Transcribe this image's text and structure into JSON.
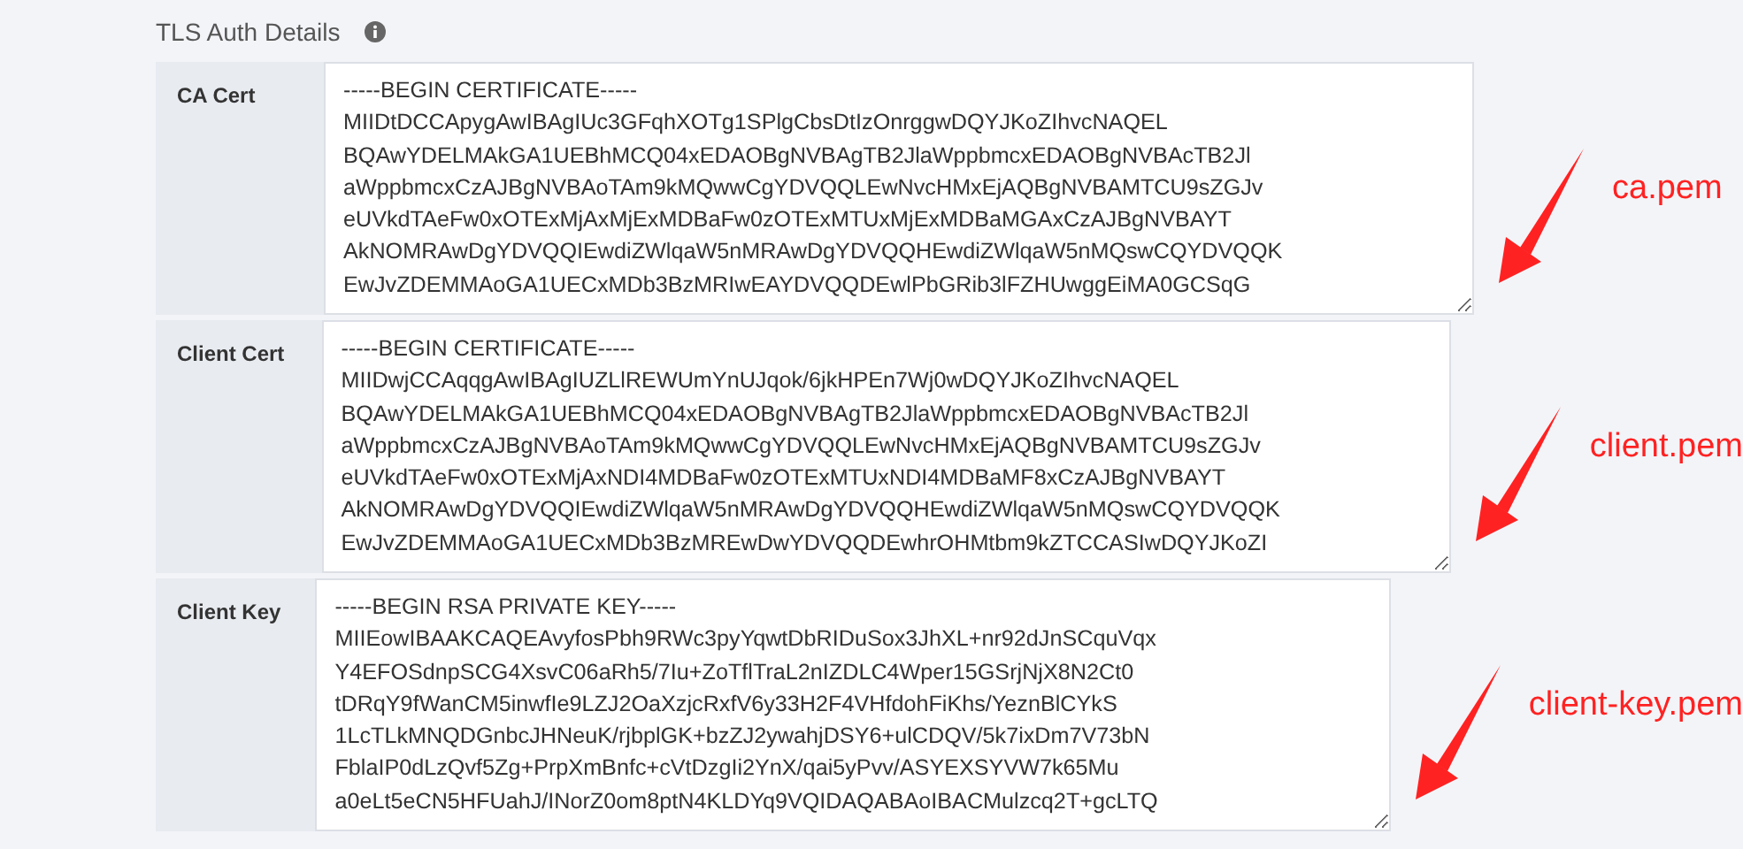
{
  "section": {
    "title": "TLS Auth Details"
  },
  "fields": [
    {
      "label": "CA Cert",
      "value": "-----BEGIN CERTIFICATE-----\nMIIDtDCCApygAwIBAgIUc3GFqhXOTg1SPlgCbsDtIzOnrggwDQYJKoZIhvcNAQEL\nBQAwYDELMAkGA1UEBhMCQ04xEDAOBgNVBAgTB2JlaWppbmcxEDAOBgNVBAcTB2Jl\naWppbmcxCzAJBgNVBAoTAm9kMQwwCgYDVQQLEwNvcHMxEjAQBgNVBAMTCU9sZGJv\neUVkdTAeFw0xOTExMjAxMjExMDBaFw0zOTExMTUxMjExMDBaMGAxCzAJBgNVBAYT\nAkNOMRAwDgYDVQQIEwdiZWlqaW5nMRAwDgYDVQQHEwdiZWlqaW5nMQswCQYDVQQK\nEwJvZDEMMAoGA1UECxMDb3BzMRIwEAYDVQQDEwlPbGRib3lFZHUwggEiMA0GCSqG",
      "annotation": "ca.pem"
    },
    {
      "label": "Client Cert",
      "value": "-----BEGIN CERTIFICATE-----\nMIIDwjCCAqqgAwIBAgIUZLlREWUmYnUJqok/6jkHPEn7Wj0wDQYJKoZIhvcNAQEL\nBQAwYDELMAkGA1UEBhMCQ04xEDAOBgNVBAgTB2JlaWppbmcxEDAOBgNVBAcTB2Jl\naWppbmcxCzAJBgNVBAoTAm9kMQwwCgYDVQQLEwNvcHMxEjAQBgNVBAMTCU9sZGJv\neUVkdTAeFw0xOTExMjAxNDI4MDBaFw0zOTExMTUxNDI4MDBaMF8xCzAJBgNVBAYT\nAkNOMRAwDgYDVQQIEwdiZWlqaW5nMRAwDgYDVQQHEwdiZWlqaW5nMQswCQYDVQQK\nEwJvZDEMMAoGA1UECxMDb3BzMREwDwYDVQQDEwhrOHMtbm9kZTCCASIwDQYJKoZI",
      "annotation": "client.pem"
    },
    {
      "label": "Client Key",
      "value": "-----BEGIN RSA PRIVATE KEY-----\nMIIEowIBAAKCAQEAvyfosPbh9RWc3pyYqwtDbRIDuSox3JhXL+nr92dJnSCquVqx\nY4EFOSdnpSCG4XsvC06aRh5/7Iu+ZoTflTraL2nIZDLC4Wper15GSrjNjX8N2Ct0\ntDRqY9fWanCM5inwfIe9LZJ2OaXzjcRxfV6y33H2F4VHfdohFiKhs/YeznBlCYkS\n1LcTLkMNQDGnbcJHNeuK/rjbplGK+bzZJ2ywahjDSY6+ulCDQV/5k7ixDm7V73bN\nFblaIP0dLzQvf5Zg+PrpXmBnfc+cVtDzgIi2YnX/qai5yPvv/ASYEXSYVW7k65Mu\na0eLt5eCN5HFUahJ/INorZ0om8ptN4KLDYq9VQIDAQABAoIBACMulzcq2T+gcLTQ",
      "annotation": "client-key.pem"
    }
  ]
}
